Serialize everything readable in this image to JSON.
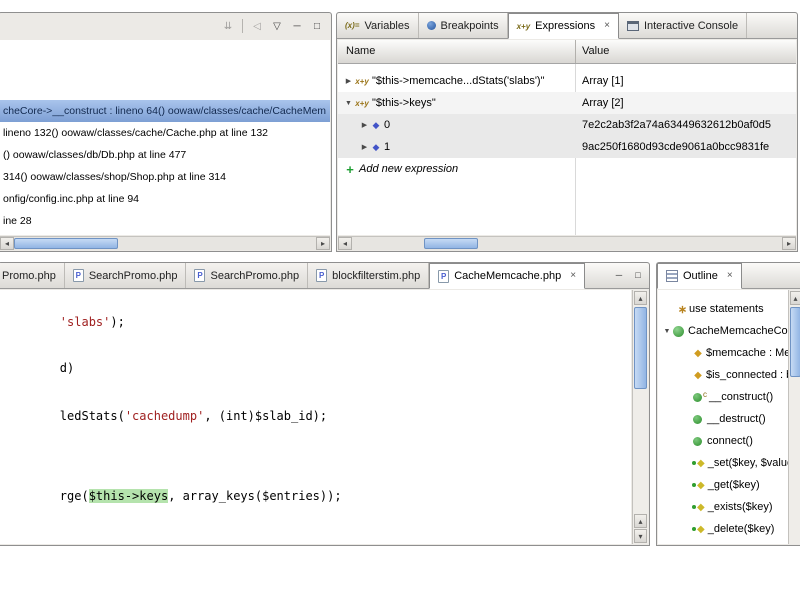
{
  "icons": {
    "collapse_all": "⇊",
    "back": "◁",
    "view_menu": "▽",
    "minimize": "─",
    "maximize": "□",
    "close": "×",
    "collapsed": "▶",
    "expanded": "▼",
    "scroll_left": "◂",
    "scroll_right": "▸",
    "scroll_up": "▴",
    "scroll_down": "▾",
    "add": "+",
    "element": "◆",
    "field": "◆",
    "variables": "(x)=",
    "expressions": "x+y",
    "php_file": "P",
    "use_statements": "∗",
    "constructor_decorator": "c"
  },
  "debug": {
    "frames": [
      {
        "text": "cheCore->__construct : lineno 64() oowaw/classes/cache/CacheMem",
        "selected": true
      },
      {
        "text": "lineno 132() oowaw/classes/cache/Cache.php at line 132",
        "selected": false
      },
      {
        "text": "() oowaw/classes/db/Db.php at line 477",
        "selected": false
      },
      {
        "text": "314() oowaw/classes/shop/Shop.php at line 314",
        "selected": false
      },
      {
        "text": "onfig/config.inc.php at line 94",
        "selected": false
      },
      {
        "text": "ine 28",
        "selected": false
      }
    ]
  },
  "expressions": {
    "tabs": {
      "variables": "Variables",
      "breakpoints": "Breakpoints",
      "expressions": "Expressions",
      "console": "Interactive Console"
    },
    "columns": {
      "name": "Name",
      "value": "Value"
    },
    "rows": [
      {
        "name": "\"$this->memcache...dStats('slabs')\"",
        "value": "Array [1]"
      },
      {
        "name": "\"$this->keys\"",
        "value": "Array [2]"
      },
      {
        "name": "0",
        "value": "7e2c2ab3f2a74a63449632612b0af0d5"
      },
      {
        "name": "1",
        "value": "9ac250f1680d93cde9061a0bcc9831fe"
      }
    ],
    "add_new_label": "Add new expression"
  },
  "editor": {
    "tabs": [
      "Promo.php",
      "SearchPromo.php",
      "SearchPromo.php",
      "blockfilterstim.php",
      "CacheMemcache.php"
    ],
    "code": {
      "line1": {
        "string": "'slabs'",
        "rest": ");"
      },
      "line2": "d)",
      "line3": {
        "pre": "ledStats(",
        "string": "'cachedump'",
        "post": ", (int)$slab_id);"
      },
      "line4": {
        "pre": "rge(",
        "highlight": "$this->keys",
        "post": ", array_keys($entries));"
      }
    }
  },
  "outline": {
    "tab_label": "Outline",
    "items": [
      "use statements",
      "CacheMemcacheCore",
      "$memcache : Mem",
      "$is_connected : bo",
      "__construct()",
      "__destruct()",
      "connect()",
      "_set($key, $value,",
      "_get($key)",
      "_exists($key)",
      "_delete($key)"
    ]
  }
}
